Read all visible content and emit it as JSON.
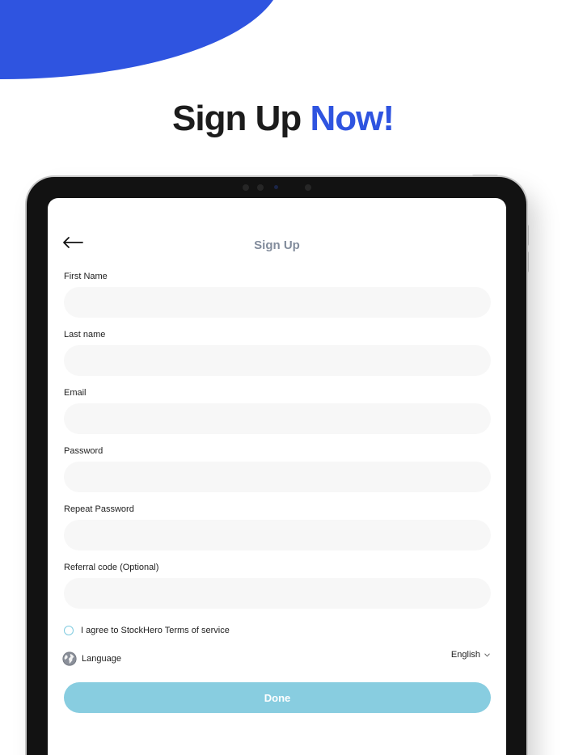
{
  "headline": {
    "part1": "Sign Up ",
    "part2": "Now!"
  },
  "colors": {
    "accent_blue": "#2f54e0",
    "done_button": "#88cde0",
    "input_bg": "#f7f7f7",
    "device_frame": "#121212"
  },
  "screen": {
    "title": "Sign Up",
    "back_icon": "arrow-left-icon"
  },
  "fields": [
    {
      "label": "First Name",
      "value": "",
      "placeholder": ""
    },
    {
      "label": "Last name",
      "value": "",
      "placeholder": ""
    },
    {
      "label": "Email",
      "value": "",
      "placeholder": ""
    },
    {
      "label": "Password",
      "value": "",
      "placeholder": ""
    },
    {
      "label": "Repeat Password",
      "value": "",
      "placeholder": ""
    },
    {
      "label": "Referral code (Optional)",
      "value": "",
      "placeholder": ""
    }
  ],
  "terms": {
    "text": "I agree to StockHero Terms of service",
    "checked": false
  },
  "language": {
    "label": "Language",
    "selected": "English",
    "icon": "globe-icon"
  },
  "done_button": {
    "label": "Done"
  }
}
